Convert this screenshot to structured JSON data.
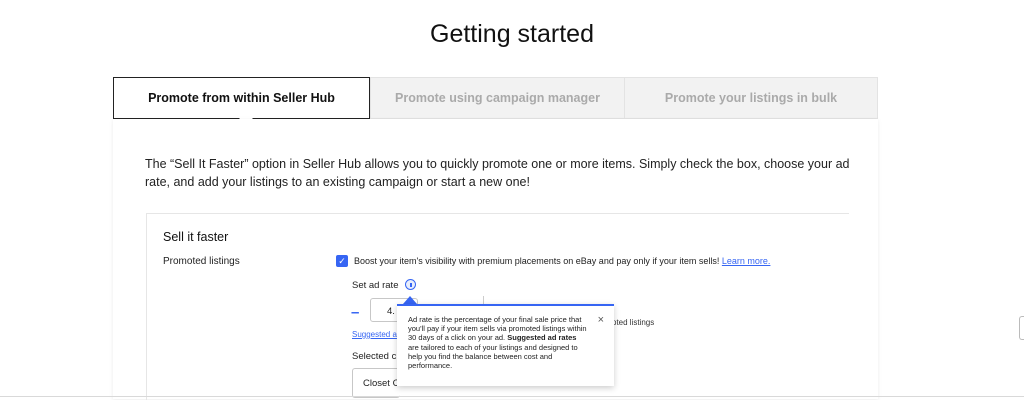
{
  "page": {
    "title": "Getting started"
  },
  "tabs": [
    {
      "label": "Promote from within Seller Hub",
      "active": true
    },
    {
      "label": "Promote using campaign manager",
      "active": false
    },
    {
      "label": "Promote your listings in bulk",
      "active": false
    }
  ],
  "description": "The “Sell It Faster” option in Seller Hub allows you to quickly promote one or more items. Simply check the box, choose your ad rate, and add your listings to an existing campaign or start a new one!",
  "card": {
    "title": "Sell it faster",
    "promoted_label": "Promoted listings",
    "checkbox_checked": true,
    "boost_text": "Boost your item's visibility with premium placements on eBay and pay only if your item sells!",
    "learn_more": "Learn more.",
    "ad_rate_label": "Set ad rate",
    "ad_rate_value": "4.",
    "minus_symbol": "–",
    "suggested_link": "Suggested a",
    "selected_label": "Selected c",
    "selected_value": "Closet C",
    "peek_text": "oted listings"
  },
  "tooltip": {
    "text_1": "Ad rate is the percentage of your final sale price that you'll pay if your item sells via promoted listings within 30 days of a click on your ad.",
    "bold": "Suggested ad rates",
    "text_2": "are tailored to each of your listings and designed to help you find the balance between cost and performance.",
    "close_symbol": "×"
  },
  "colors": {
    "accent": "#3665f3",
    "inactive_tab_bg": "#f2f2f2",
    "inactive_tab_text": "#aaaaaa"
  },
  "icons": {
    "checkbox": "checkmark-icon",
    "info": "info-icon",
    "close": "close-icon",
    "minus": "minus-icon"
  }
}
